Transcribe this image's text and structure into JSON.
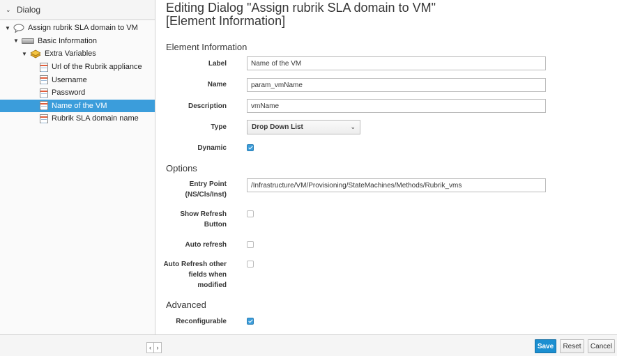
{
  "sidebar": {
    "header": "Dialog",
    "tree": {
      "root": "Assign rubrik SLA domain to VM",
      "tab": "Basic Information",
      "box": "Extra Variables",
      "items": [
        "Url of the Rubrik appliance",
        "Username",
        "Password",
        "Name of the VM",
        "Rubrik SLA domain name"
      ],
      "selected_item": "Name of the VM"
    }
  },
  "main": {
    "title": "Editing Dialog \"Assign rubrik SLA domain to VM\" [Element Information]",
    "sections": {
      "element_info": "Element Information",
      "options": "Options",
      "advanced": "Advanced"
    },
    "fields": {
      "label": {
        "label": "Label",
        "value": "Name of the VM"
      },
      "name": {
        "label": "Name",
        "value": "param_vmName"
      },
      "description": {
        "label": "Description",
        "value": "vmName"
      },
      "type": {
        "label": "Type",
        "value": "Drop Down List"
      },
      "dynamic": {
        "label": "Dynamic",
        "checked": true
      },
      "entry_point": {
        "label_line1": "Entry Point",
        "label_line2": "(NS/Cls/Inst)",
        "value": "/Infrastructure/VM/Provisioning/StateMachines/Methods/Rubrik_vms"
      },
      "show_refresh": {
        "label_line1": "Show Refresh",
        "label_line2": "Button",
        "checked": false
      },
      "auto_refresh": {
        "label": "Auto refresh",
        "checked": false
      },
      "auto_refresh_other": {
        "label_line1": "Auto Refresh other",
        "label_line2": "fields when",
        "label_line3": "modified",
        "checked": false
      },
      "reconfigurable": {
        "label": "Reconfigurable",
        "checked": true
      }
    }
  },
  "footer": {
    "pager_prev": "‹",
    "pager_next": "›",
    "save": "Save",
    "reset": "Reset",
    "cancel": "Cancel"
  },
  "colors": {
    "accent": "#3b9ddb",
    "primary_button": "#1b8fd1"
  }
}
